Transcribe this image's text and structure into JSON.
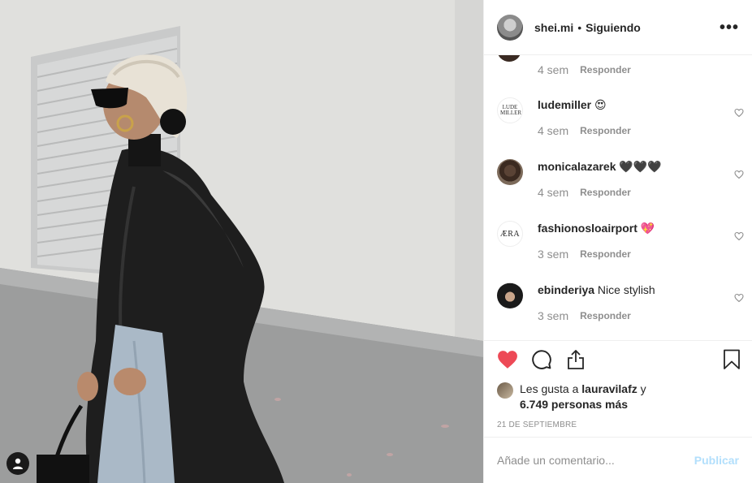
{
  "header": {
    "username": "shei.mi",
    "separator": "•",
    "follow_label": "Siguiendo",
    "more_label": "•••"
  },
  "partial_comment": {
    "time": "4 sem",
    "reply_label": "Responder"
  },
  "comments": [
    {
      "username": "ludemiller",
      "text": "😍",
      "time": "4 sem",
      "reply_label": "Responder",
      "avatar_text": "LUDE MILLER"
    },
    {
      "username": "monicalazarek",
      "text": "🖤🖤🖤",
      "time": "4 sem",
      "reply_label": "Responder"
    },
    {
      "username": "fashionosloairport",
      "text": "💖",
      "time": "3 sem",
      "reply_label": "Responder",
      "avatar_text": "ÆRA"
    },
    {
      "username": "ebinderiya",
      "text": "Nice stylish",
      "time": "3 sem",
      "reply_label": "Responder"
    }
  ],
  "likes": {
    "prefix": "Les gusta a ",
    "user": "lauravilafz",
    "connector": " y",
    "others": "6.749 personas más"
  },
  "date": "21 DE SEPTIEMBRE",
  "add_comment": {
    "placeholder": "Añade un comentario...",
    "publish_label": "Publicar"
  },
  "colors": {
    "heart_liked": "#ed4956",
    "publish_disabled": "#b2dffc",
    "meta_text": "#8e8e8e",
    "primary_text": "#262626"
  },
  "icons": {
    "like": "heart-icon",
    "comment": "comment-icon",
    "share": "share-icon",
    "save": "bookmark-icon",
    "tag": "user-tag-icon",
    "comment_like": "small-heart-icon"
  }
}
